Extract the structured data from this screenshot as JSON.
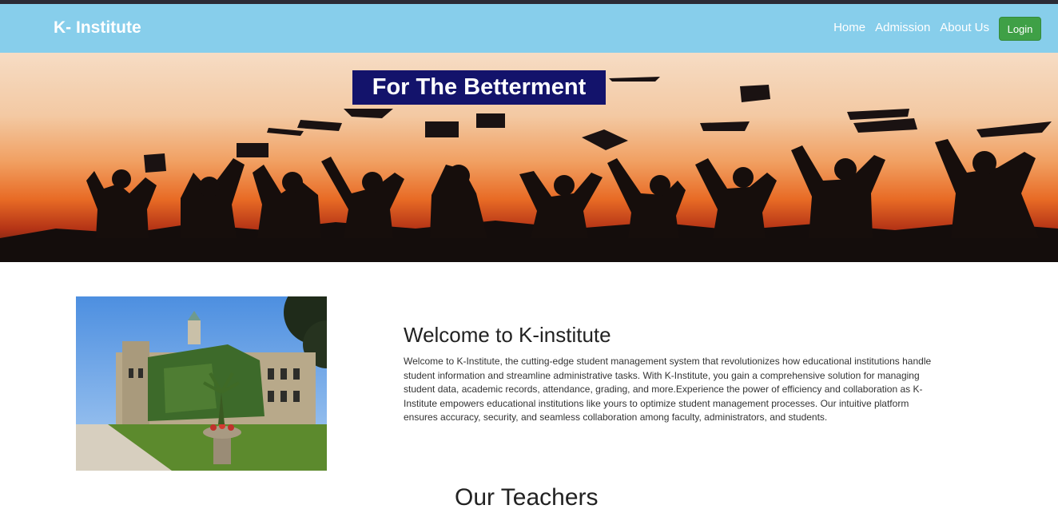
{
  "navbar": {
    "brand": "K- Institute",
    "links": [
      "Home",
      "Admission",
      "About Us"
    ],
    "login_label": "Login"
  },
  "hero": {
    "banner_text": "For The Betterment"
  },
  "welcome": {
    "title": "Welcome to K-institute",
    "body": "Welcome to K-Institute, the cutting-edge student management system that revolutionizes how educational institutions handle student information and streamline administrative tasks. With K-Institute, you gain a comprehensive solution for managing student data, academic records, attendance, grading, and more.Experience the power of efficiency and collaboration as K-Institute empowers educational institutions like yours to optimize student management processes. Our intuitive platform ensures accuracy, security, and seamless collaboration among faculty, administrators, and students."
  },
  "teachers": {
    "title": "Our Teachers"
  },
  "colors": {
    "navbar": "#87ceeb",
    "login_button": "#3fa046",
    "banner": "#13136b"
  }
}
